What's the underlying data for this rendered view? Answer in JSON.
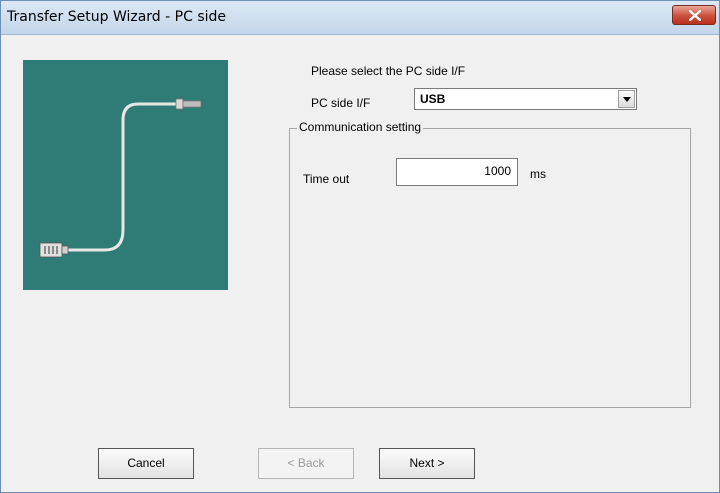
{
  "window": {
    "title": "Transfer Setup Wizard - PC side"
  },
  "prompt": "Please select the PC side I/F",
  "pc_if": {
    "label": "PC side I/F",
    "selected": "USB"
  },
  "comm": {
    "group_label": "Communication setting",
    "timeout_label": "Time out",
    "timeout_value": "1000",
    "unit": "ms"
  },
  "buttons": {
    "cancel": "Cancel",
    "back": "< Back",
    "next": "Next >"
  },
  "icons": {
    "close": "close-icon",
    "picture": "usb-cable-illustration",
    "dropdown": "chevron-down-icon"
  },
  "colors": {
    "picture_bg": "#2f7b76",
    "close_button": "#c9503c"
  }
}
